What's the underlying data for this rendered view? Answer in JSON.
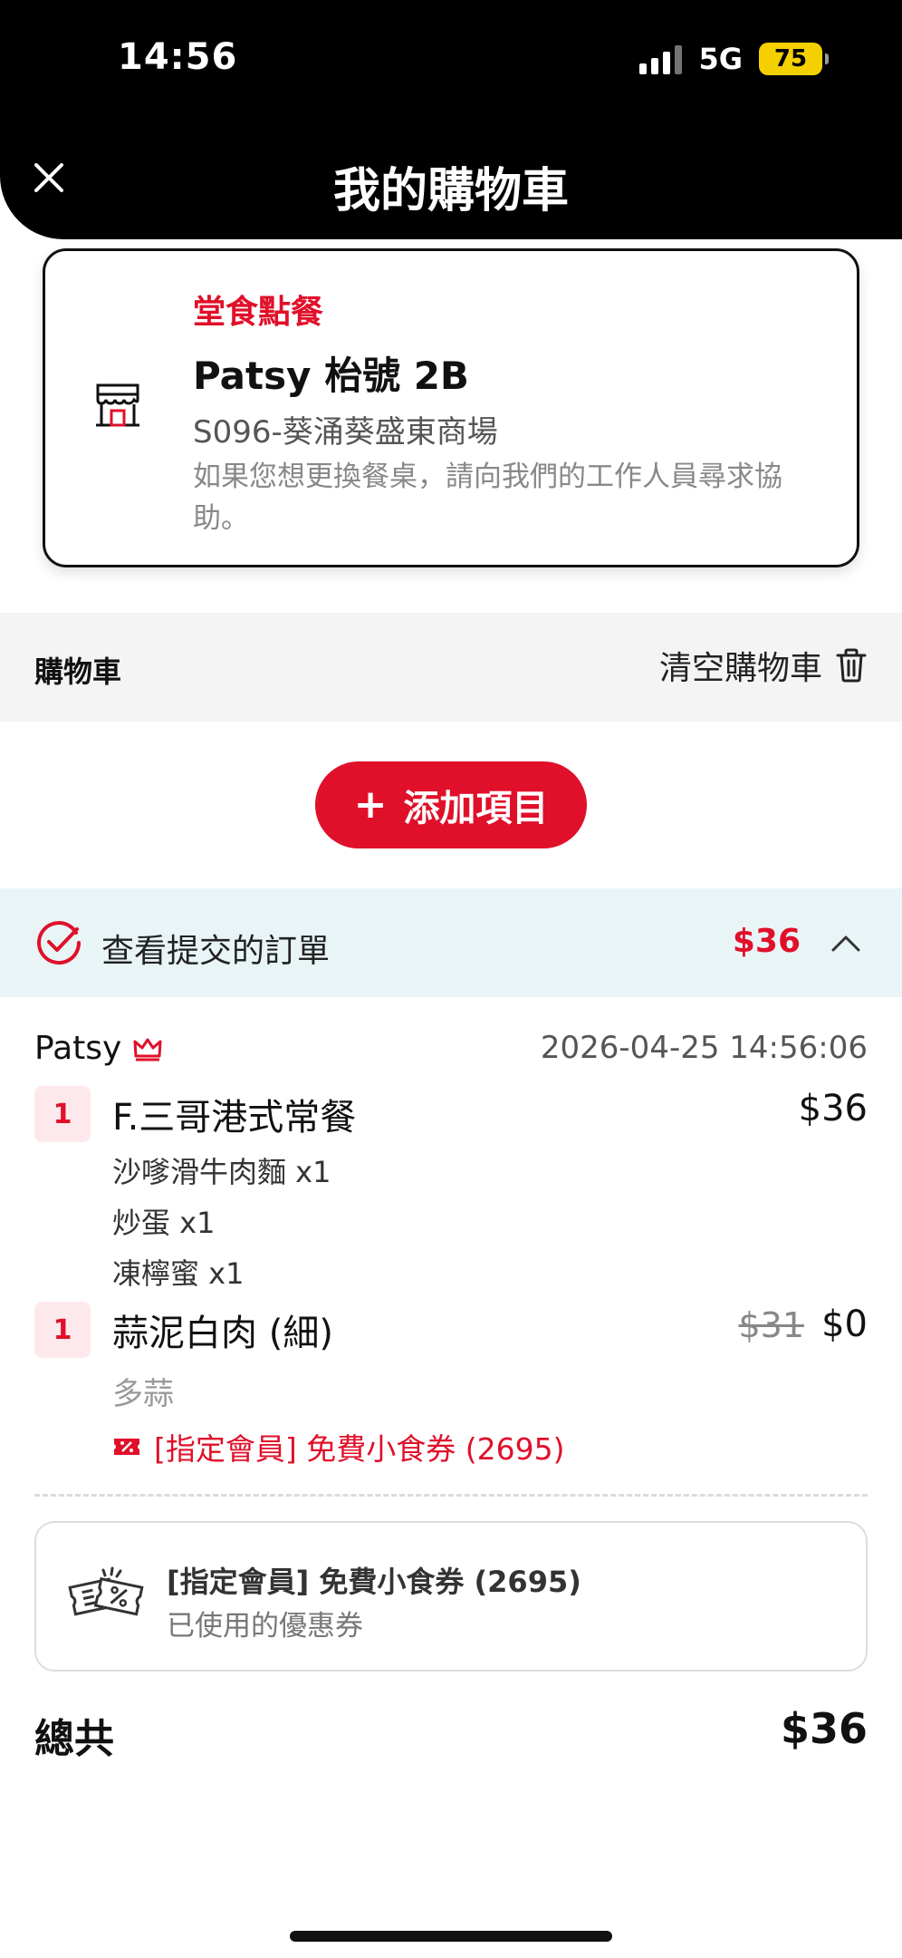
{
  "status_bar": {
    "time": "14:56",
    "network": "5G",
    "battery": "75"
  },
  "header": {
    "title": "我的購物車"
  },
  "store": {
    "order_type": "堂食點餐",
    "table": "Patsy 枱號 2B",
    "store_name": "S096-葵涌葵盛東商場",
    "note": "如果您想更換餐桌，請向我們的工作人員尋求協助。"
  },
  "cart": {
    "label": "購物車",
    "clear_label": "清空購物車"
  },
  "add_item": {
    "label": "添加項目"
  },
  "submitted": {
    "label": "查看提交的訂單",
    "total": "$36"
  },
  "order": {
    "orderer": "Patsy",
    "timestamp": "2026-04-25 14:56:06",
    "items": [
      {
        "qty": "1",
        "name": "F.三哥港式常餐",
        "price": "$36",
        "options": [
          "沙嗲滑牛肉麵  x1",
          "炒蛋 x1",
          "凍檸蜜 x1"
        ]
      },
      {
        "qty": "1",
        "name": "蒜泥白肉 (細)",
        "original_price": "$31",
        "price": "$0",
        "options": [
          "多蒜"
        ],
        "coupon": "[指定會員] 免費小食券 (2695)"
      }
    ]
  },
  "coupon_card": {
    "title": "[指定會員] 免費小食券 (2695)",
    "subtitle": "已使用的優惠券"
  },
  "total": {
    "label": "總共",
    "value": "$36"
  },
  "colors": {
    "accent": "#e0102a",
    "header_bg": "#000000",
    "orders_bar_bg": "#e8f4f6"
  }
}
